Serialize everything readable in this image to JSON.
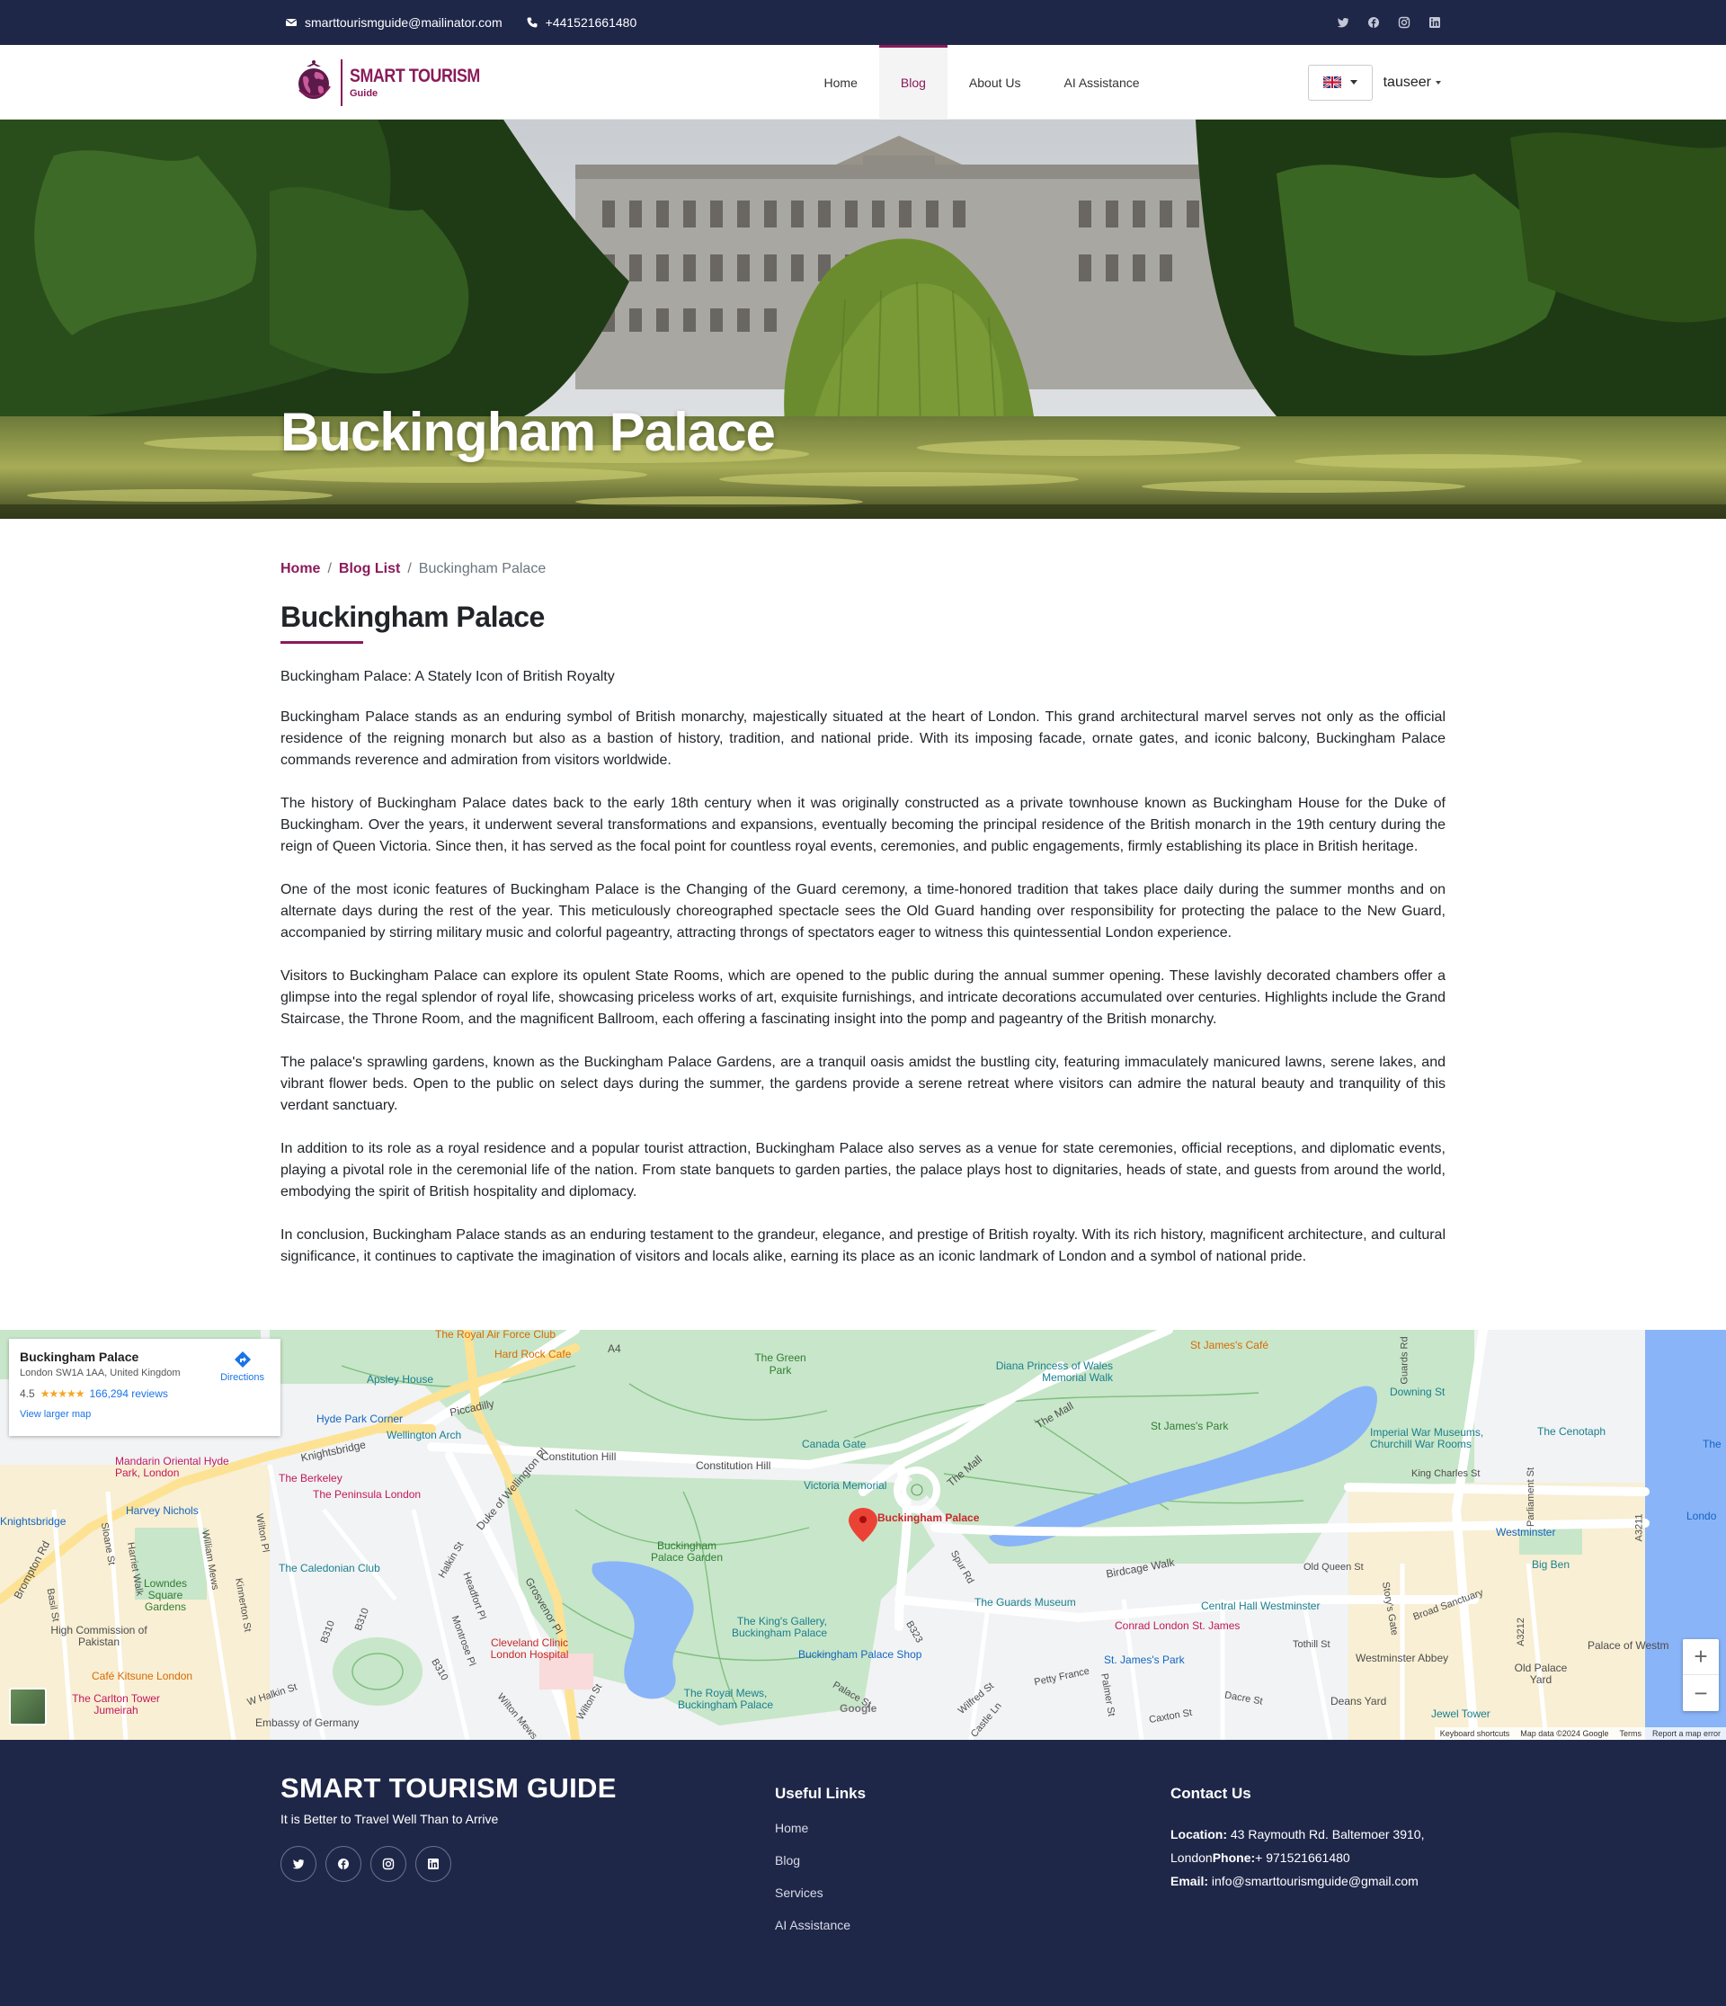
{
  "topbar": {
    "email": "smarttourismguide@mailinator.com",
    "phone": "+441521661480",
    "socials": [
      "twitter-icon",
      "facebook-icon",
      "instagram-icon",
      "linkedin-icon"
    ]
  },
  "nav": {
    "brand_title": "SMART TOURISM",
    "brand_sub": "Guide",
    "items": [
      {
        "label": "Home",
        "active": false
      },
      {
        "label": "Blog",
        "active": true
      },
      {
        "label": "About Us",
        "active": false
      },
      {
        "label": "AI Assistance",
        "active": false
      }
    ],
    "language": "en-gb-flag",
    "user": "tauseer"
  },
  "hero": {
    "title": "Buckingham Palace"
  },
  "breadcrumb": {
    "home": "Home",
    "blog_list": "Blog List",
    "current": "Buckingham Palace"
  },
  "article": {
    "title": "Buckingham Palace",
    "subtitle": "Buckingham Palace: A Stately Icon of British Royalty",
    "paragraphs": [
      "Buckingham Palace stands as an enduring symbol of British monarchy, majestically situated at the heart of London. This grand architectural marvel serves not only as the official residence of the reigning monarch but also as a bastion of history, tradition, and national pride. With its imposing facade, ornate gates, and iconic balcony, Buckingham Palace commands reverence and admiration from visitors worldwide.",
      "The history of Buckingham Palace dates back to the early 18th century when it was originally constructed as a private townhouse known as Buckingham House for the Duke of Buckingham. Over the years, it underwent several transformations and expansions, eventually becoming the principal residence of the British monarch in the 19th century during the reign of Queen Victoria. Since then, it has served as the focal point for countless royal events, ceremonies, and public engagements, firmly establishing its place in British heritage.",
      "One of the most iconic features of Buckingham Palace is the Changing of the Guard ceremony, a time-honored tradition that takes place daily during the summer months and on alternate days during the rest of the year. This meticulously choreographed spectacle sees the Old Guard handing over responsibility for protecting the palace to the New Guard, accompanied by stirring military music and colorful pageantry, attracting throngs of spectators eager to witness this quintessential London experience.",
      "Visitors to Buckingham Palace can explore its opulent State Rooms, which are opened to the public during the annual summer opening. These lavishly decorated chambers offer a glimpse into the regal splendor of royal life, showcasing priceless works of art, exquisite furnishings, and intricate decorations accumulated over centuries. Highlights include the Grand Staircase, the Throne Room, and the magnificent Ballroom, each offering a fascinating insight into the pomp and pageantry of the British monarchy.",
      "The palace's sprawling gardens, known as the Buckingham Palace Gardens, are a tranquil oasis amidst the bustling city, featuring immaculately manicured lawns, serene lakes, and vibrant flower beds. Open to the public on select days during the summer, the gardens provide a serene retreat where visitors can admire the natural beauty and tranquility of this verdant sanctuary.",
      "In addition to its role as a royal residence and a popular tourist attraction, Buckingham Palace also serves as a venue for state ceremonies, official receptions, and diplomatic events, playing a pivotal role in the ceremonial life of the nation. From state banquets to garden parties, the palace plays host to dignitaries, heads of state, and guests from around the world, embodying the spirit of British hospitality and diplomacy.",
      "In conclusion, Buckingham Palace stands as an enduring testament to the grandeur, elegance, and prestige of British royalty. With its rich history, magnificent architecture, and cultural significance, it continues to captivate the imagination of visitors and locals alike, earning its place as an iconic landmark of London and a symbol of national pride."
    ]
  },
  "map": {
    "place_name": "Buckingham Palace",
    "address": "London SW1A 1AA, United Kingdom",
    "rating": "4.5",
    "stars": "★★★★★",
    "reviews": "166,294 reviews",
    "view_larger": "View larger map",
    "directions": "Directions",
    "pin_label": "Buckingham Palace",
    "zoom_in": "+",
    "zoom_out": "−",
    "attribution": [
      "Keyboard shortcuts",
      "Map data ©2024 Google",
      "Terms",
      "Report a map error"
    ],
    "google": "Google",
    "labels": [
      {
        "text": "The Royal Air Force Club",
        "cls": "orange"
      },
      {
        "text": "Hard Rock Cafe",
        "cls": "orange"
      },
      {
        "text": "A4",
        "cls": ""
      },
      {
        "text": "The Green Park",
        "cls": "green"
      },
      {
        "text": "Diana Princess of Wales Memorial Walk",
        "cls": "teal"
      },
      {
        "text": "St James's Café",
        "cls": "orange"
      },
      {
        "text": "Apsley House",
        "cls": "teal"
      },
      {
        "text": "Piccadilly",
        "cls": ""
      },
      {
        "text": "Hyde Park Corner",
        "cls": "blue"
      },
      {
        "text": "Wellington Arch",
        "cls": "teal"
      },
      {
        "text": "Knightsbridge",
        "cls": ""
      },
      {
        "text": "Constitution Hill",
        "cls": ""
      },
      {
        "text": "Constitution Hill",
        "cls": ""
      },
      {
        "text": "Canada Gate",
        "cls": "teal"
      },
      {
        "text": "The Mall",
        "cls": ""
      },
      {
        "text": "The Mall",
        "cls": ""
      },
      {
        "text": "St James's Park",
        "cls": "green"
      },
      {
        "text": "Downing St",
        "cls": "teal"
      },
      {
        "text": "The Cenotaph",
        "cls": "teal"
      },
      {
        "text": "Imperial War Museums, Churchill War Rooms",
        "cls": "teal"
      },
      {
        "text": "King Charles St",
        "cls": ""
      },
      {
        "text": "Mandarin Oriental Hyde Park, London",
        "cls": "pink"
      },
      {
        "text": "The Berkeley",
        "cls": "pink"
      },
      {
        "text": "The Peninsula London",
        "cls": "pink"
      },
      {
        "text": "Victoria Memorial",
        "cls": "teal"
      },
      {
        "text": "Duke of Wellington Pl",
        "cls": ""
      },
      {
        "text": "Knightsbridge",
        "cls": "blue"
      },
      {
        "text": "Harvey Nichols",
        "cls": "blue"
      },
      {
        "text": "Westminster",
        "cls": "blue"
      },
      {
        "text": "Brompton Rd",
        "cls": ""
      },
      {
        "text": "Sloane St",
        "cls": ""
      },
      {
        "text": "Harriet Walk",
        "cls": ""
      },
      {
        "text": "William Mews",
        "cls": ""
      },
      {
        "text": "Wilton Pl",
        "cls": ""
      },
      {
        "text": "Lowndes Square Gardens",
        "cls": "green"
      },
      {
        "text": "The Caledonian Club",
        "cls": "teal"
      },
      {
        "text": "Halkin St",
        "cls": ""
      },
      {
        "text": "Headfort Pl",
        "cls": ""
      },
      {
        "text": "Buckingham Palace Garden",
        "cls": "green"
      },
      {
        "text": "Spur Rd",
        "cls": ""
      },
      {
        "text": "Birdcage Walk",
        "cls": ""
      },
      {
        "text": "Old Queen St",
        "cls": ""
      },
      {
        "text": "Big Ben",
        "cls": "teal"
      },
      {
        "text": "Kinnerton St",
        "cls": ""
      },
      {
        "text": "Basil St",
        "cls": ""
      },
      {
        "text": "Grosvenor Pl",
        "cls": ""
      },
      {
        "text": "The Guards Museum",
        "cls": "teal"
      },
      {
        "text": "Central Hall Westminster",
        "cls": "teal"
      },
      {
        "text": "Broad Sanctuary",
        "cls": ""
      },
      {
        "text": "High Commission of Pakistan",
        "cls": ""
      },
      {
        "text": "Cleveland Clinic London Hospital",
        "cls": "red"
      },
      {
        "text": "The King's Gallery, Buckingham Palace",
        "cls": "teal"
      },
      {
        "text": "Conrad London St. James",
        "cls": "pink"
      },
      {
        "text": "Tothill St",
        "cls": ""
      },
      {
        "text": "Westminster Abbey",
        "cls": ""
      },
      {
        "text": "Palace of Westm",
        "cls": ""
      },
      {
        "text": "Café Kitsune London",
        "cls": "orange"
      },
      {
        "text": "Montrose Pl",
        "cls": ""
      },
      {
        "text": "Buckingham Palace Shop",
        "cls": "blue"
      },
      {
        "text": "St. James's Park",
        "cls": "blue"
      },
      {
        "text": "B310",
        "cls": ""
      },
      {
        "text": "B310",
        "cls": ""
      },
      {
        "text": "B310",
        "cls": ""
      },
      {
        "text": "B323",
        "cls": ""
      },
      {
        "text": "Petty France",
        "cls": ""
      },
      {
        "text": "Palmer St",
        "cls": ""
      },
      {
        "text": "Old Palace Yard",
        "cls": ""
      },
      {
        "text": "The Carlton Tower Jumeirah",
        "cls": "pink"
      },
      {
        "text": "W Halkin St",
        "cls": ""
      },
      {
        "text": "The Royal Mews, Buckingham Palace",
        "cls": "teal"
      },
      {
        "text": "Palace St",
        "cls": ""
      },
      {
        "text": "Wilfred St",
        "cls": ""
      },
      {
        "text": "Deans Yard",
        "cls": ""
      },
      {
        "text": "Jewel Tower",
        "cls": "teal"
      },
      {
        "text": "Embassy of Germany",
        "cls": ""
      },
      {
        "text": "Wilton St",
        "cls": ""
      },
      {
        "text": "Wilton Mews",
        "cls": ""
      },
      {
        "text": "Castle Ln",
        "cls": ""
      },
      {
        "text": "Caxton St",
        "cls": ""
      },
      {
        "text": "Dacre St",
        "cls": ""
      },
      {
        "text": "Parliament St",
        "cls": ""
      },
      {
        "text": "A3212",
        "cls": ""
      },
      {
        "text": "A3211",
        "cls": ""
      },
      {
        "text": "Story's Gate",
        "cls": ""
      },
      {
        "text": "Guards Rd",
        "cls": ""
      },
      {
        "text": "Londo",
        "cls": "blue"
      },
      {
        "text": "The",
        "cls": "blue"
      }
    ]
  },
  "footer": {
    "brand": "SMART TOURISM GUIDE",
    "tagline": "It is Better to Travel Well Than to Arrive",
    "useful_heading": "Useful Links",
    "links": [
      "Home",
      "Blog",
      "Services",
      "AI Assistance"
    ],
    "contact_heading": "Contact Us",
    "location_label": "Location:",
    "location": "43 Raymouth Rd. Baltemoer 3910,",
    "city": "London",
    "phone_label": "Phone:",
    "phone": "+ 971521661480",
    "email_label": "Email:",
    "email": "info@smarttourismguide@gmail.com"
  },
  "colors": {
    "navy": "#1f2749",
    "accent": "#8a1b5a",
    "park": "#c8e6c9",
    "water": "#8ab4f8"
  }
}
